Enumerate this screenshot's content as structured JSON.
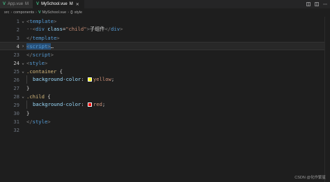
{
  "tabs": [
    {
      "label": "App.vue",
      "modifier": "M",
      "active": false
    },
    {
      "label": "MySchool.vue",
      "modifier": "M",
      "active": true
    }
  ],
  "breadcrumb": {
    "src": "src",
    "components": "components",
    "file": "MySchool.vue",
    "section": "style"
  },
  "lines": {
    "l1": {
      "num": "1"
    },
    "l2": {
      "num": "2",
      "tag_open": "div",
      "attr": "class",
      "attr_value": "\"child\"",
      "text": "子组件",
      "tag_close": "div"
    },
    "l3": {
      "num": "3"
    },
    "l4": {
      "num": "4",
      "rest": "…"
    },
    "l23": {
      "num": "23"
    },
    "l24": {
      "num": "24"
    },
    "l25": {
      "num": "25",
      "selector": ".container"
    },
    "l26": {
      "num": "26",
      "prop": "background-color",
      "value": "yellow"
    },
    "l27": {
      "num": "27"
    },
    "l28": {
      "num": "28",
      "selector": ".child"
    },
    "l29": {
      "num": "29",
      "prop": "background-color",
      "value": "red"
    },
    "l30": {
      "num": "30"
    },
    "l31": {
      "num": "31"
    },
    "l32": {
      "num": "32"
    }
  },
  "tags": {
    "template": "template",
    "script": "script",
    "style": "style"
  },
  "colors": {
    "yellow_swatch": "#ffff00",
    "red_swatch": "#ff0000",
    "vue_green": "#41b883"
  },
  "watermark": "CSDN @化作繁星"
}
